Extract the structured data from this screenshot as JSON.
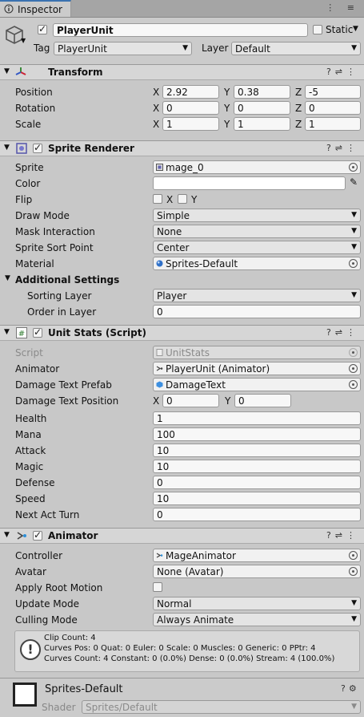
{
  "tab": {
    "title": "Inspector",
    "icon": "info-icon",
    "actions": "⋮ ≡"
  },
  "header": {
    "active": true,
    "name": "PlayerUnit",
    "static_label": "Static",
    "tag_label": "Tag",
    "tag_value": "PlayerUnit",
    "layer_label": "Layer",
    "layer_value": "Default"
  },
  "transform": {
    "title": "Transform",
    "rows": [
      {
        "label": "Position",
        "x": "2.92",
        "y": "0.38",
        "z": "-5"
      },
      {
        "label": "Rotation",
        "x": "0",
        "y": "0",
        "z": "0"
      },
      {
        "label": "Scale",
        "x": "1",
        "y": "1",
        "z": "1"
      }
    ],
    "axes": [
      "X",
      "Y",
      "Z"
    ]
  },
  "sprite_renderer": {
    "title": "Sprite Renderer",
    "sprite_label": "Sprite",
    "sprite_value": "mage_0",
    "color_label": "Color",
    "flip_label": "Flip",
    "flip_x": "X",
    "flip_y": "Y",
    "draw_mode_label": "Draw Mode",
    "draw_mode_value": "Simple",
    "mask_label": "Mask Interaction",
    "mask_value": "None",
    "sort_point_label": "Sprite Sort Point",
    "sort_point_value": "Center",
    "material_label": "Material",
    "material_value": "Sprites-Default",
    "additional_label": "Additional Settings",
    "sorting_layer_label": "Sorting Layer",
    "sorting_layer_value": "Player",
    "order_label": "Order in Layer",
    "order_value": "0"
  },
  "unit_stats": {
    "title": "Unit Stats (Script)",
    "script_label": "Script",
    "script_value": "UnitStats",
    "animator_label": "Animator",
    "animator_value": "PlayerUnit (Animator)",
    "prefab_label": "Damage Text Prefab",
    "prefab_value": "DamageText",
    "pos_label": "Damage Text Position",
    "pos_x": "0",
    "pos_y": "0",
    "fields": [
      {
        "label": "Health",
        "value": "1"
      },
      {
        "label": "Mana",
        "value": "100"
      },
      {
        "label": "Attack",
        "value": "10"
      },
      {
        "label": "Magic",
        "value": "10"
      },
      {
        "label": "Defense",
        "value": "0"
      },
      {
        "label": "Speed",
        "value": "10"
      },
      {
        "label": "Next Act Turn",
        "value": "0"
      }
    ]
  },
  "animator": {
    "title": "Animator",
    "controller_label": "Controller",
    "controller_value": "MageAnimator",
    "avatar_label": "Avatar",
    "avatar_value": "None (Avatar)",
    "root_motion_label": "Apply Root Motion",
    "update_label": "Update Mode",
    "update_value": "Normal",
    "culling_label": "Culling Mode",
    "culling_value": "Always Animate",
    "info_lines": [
      "Clip Count: 4",
      "Curves Pos: 0 Quat: 0 Euler: 0 Scale: 0 Muscles: 0 Generic: 0 PPtr: 4",
      "Curves Count: 4 Constant: 0 (0.0%) Dense: 0 (0.0%) Stream: 4 (100.0%)"
    ]
  },
  "material": {
    "name": "Sprites-Default",
    "shader_label": "Shader",
    "shader_value": "Sprites/Default"
  }
}
